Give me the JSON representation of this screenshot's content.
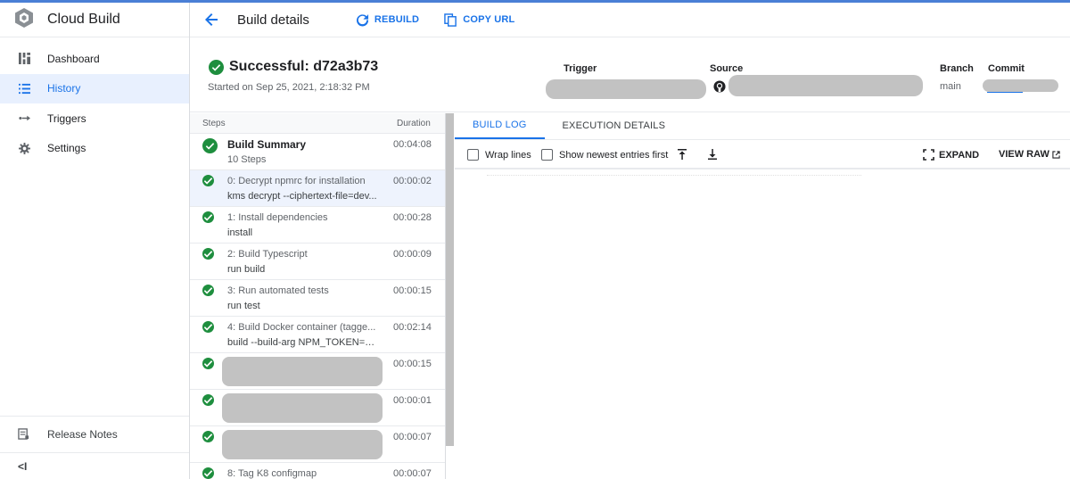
{
  "app": {
    "title": "Cloud Build",
    "logo_icon": "cloud-build-icon"
  },
  "sidebar": {
    "items": [
      {
        "label": "Dashboard",
        "icon": "dashboard-icon",
        "active": false
      },
      {
        "label": "History",
        "icon": "list-icon",
        "active": true
      },
      {
        "label": "Triggers",
        "icon": "triggers-icon",
        "active": false
      },
      {
        "label": "Settings",
        "icon": "gear-icon",
        "active": false
      }
    ],
    "release_notes": "Release Notes",
    "collapse_label": "<I"
  },
  "header": {
    "title": "Build details",
    "rebuild_label": "REBUILD",
    "copy_url_label": "COPY URL"
  },
  "build": {
    "status": "Successful: d72a3b73",
    "started": "Started on Sep 25, 2021, 2:18:32 PM",
    "trigger_label": "Trigger",
    "source_label": "Source",
    "branch_label": "Branch",
    "branch_value": "main",
    "commit_label": "Commit"
  },
  "steps": {
    "header_steps": "Steps",
    "header_duration": "Duration",
    "summary": {
      "title": "Build Summary",
      "subtitle": "10 Steps",
      "duration": "00:04:08"
    },
    "items": [
      {
        "title": "0: Decrypt npmrc for installation",
        "subtitle": "kms decrypt --ciphertext-file=dev...",
        "duration": "00:00:02",
        "selected": true
      },
      {
        "title": "1: Install dependencies",
        "subtitle": "install",
        "duration": "00:00:28"
      },
      {
        "title": "2: Build Typescript",
        "subtitle": "run build",
        "duration": "00:00:09"
      },
      {
        "title": "3: Run automated tests",
        "subtitle": "run test",
        "duration": "00:00:15"
      },
      {
        "title": "4: Build Docker container (tagge...",
        "subtitle": "build --build-arg NPM_TOKEN=92...",
        "duration": "00:02:14"
      },
      {
        "redacted": true,
        "duration": "00:00:15"
      },
      {
        "redacted": true,
        "duration": "00:00:01"
      },
      {
        "redacted": true,
        "duration": "00:00:07"
      },
      {
        "title": "8: Tag K8 configmap",
        "subtitle": "",
        "duration": "00:00:07"
      }
    ]
  },
  "log": {
    "tabs": [
      "BUILD LOG",
      "EXECUTION DETAILS"
    ],
    "wrap_lines": "Wrap lines",
    "newest_first": "Show newest entries first",
    "expand_label": "EXPAND",
    "view_raw_label": "VIEW RAW"
  },
  "colors": {
    "accent": "#1a73e8",
    "success": "#1e8e3e",
    "redaction": "#c2c2c2"
  }
}
